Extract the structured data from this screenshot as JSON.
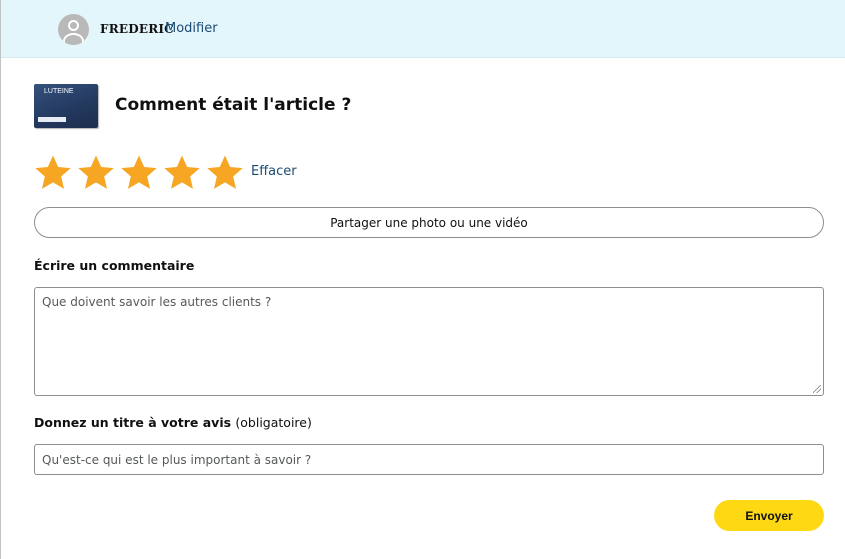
{
  "header": {
    "username": "FREDERIC",
    "edit_label": "Modifier"
  },
  "product": {
    "thumb_brand": "LUTEINE",
    "thumb_subtext": "",
    "question": "Comment était l'article ?"
  },
  "rating": {
    "stars": 5,
    "max": 5,
    "clear_label": "Effacer",
    "star_color": "#f6a623"
  },
  "share_button_label": "Partager une photo ou une vidéo",
  "comment": {
    "label": "Écrire un commentaire",
    "placeholder": "Que doivent savoir les autres clients ?"
  },
  "review_title": {
    "label": "Donnez un titre à votre avis",
    "required_note": "(obligatoire)",
    "placeholder": "Qu'est-ce qui est le plus important à savoir ?"
  },
  "submit_label": "Envoyer",
  "colors": {
    "header_bg": "#e3f6fb",
    "link": "#1a4b73",
    "submit_bg": "#ffd814"
  }
}
